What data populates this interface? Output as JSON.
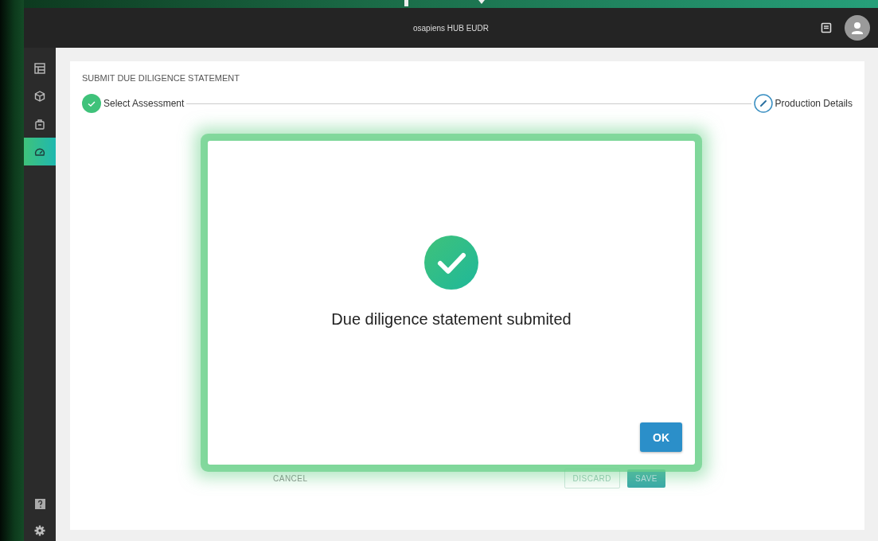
{
  "app_bar": {
    "title": "osapiens HUB EUDR"
  },
  "sidebar": {
    "items": [
      {
        "selected": false
      },
      {
        "selected": false
      },
      {
        "selected": false
      },
      {
        "selected": true
      }
    ]
  },
  "page": {
    "title": "SUBMIT DUE DILIGENCE STATEMENT",
    "steps": [
      {
        "label": "Select Assessment",
        "kind": "done"
      },
      {
        "label": "Production Details",
        "kind": "current"
      }
    ],
    "buttons": [
      {
        "label": "CANCEL",
        "kind": "text"
      },
      {
        "label": "DISCARD",
        "kind": "outlined"
      },
      {
        "label": "SAVE",
        "kind": "filled"
      }
    ]
  },
  "dialog": {
    "message": "Due diligence statement submited",
    "button": "OK"
  }
}
